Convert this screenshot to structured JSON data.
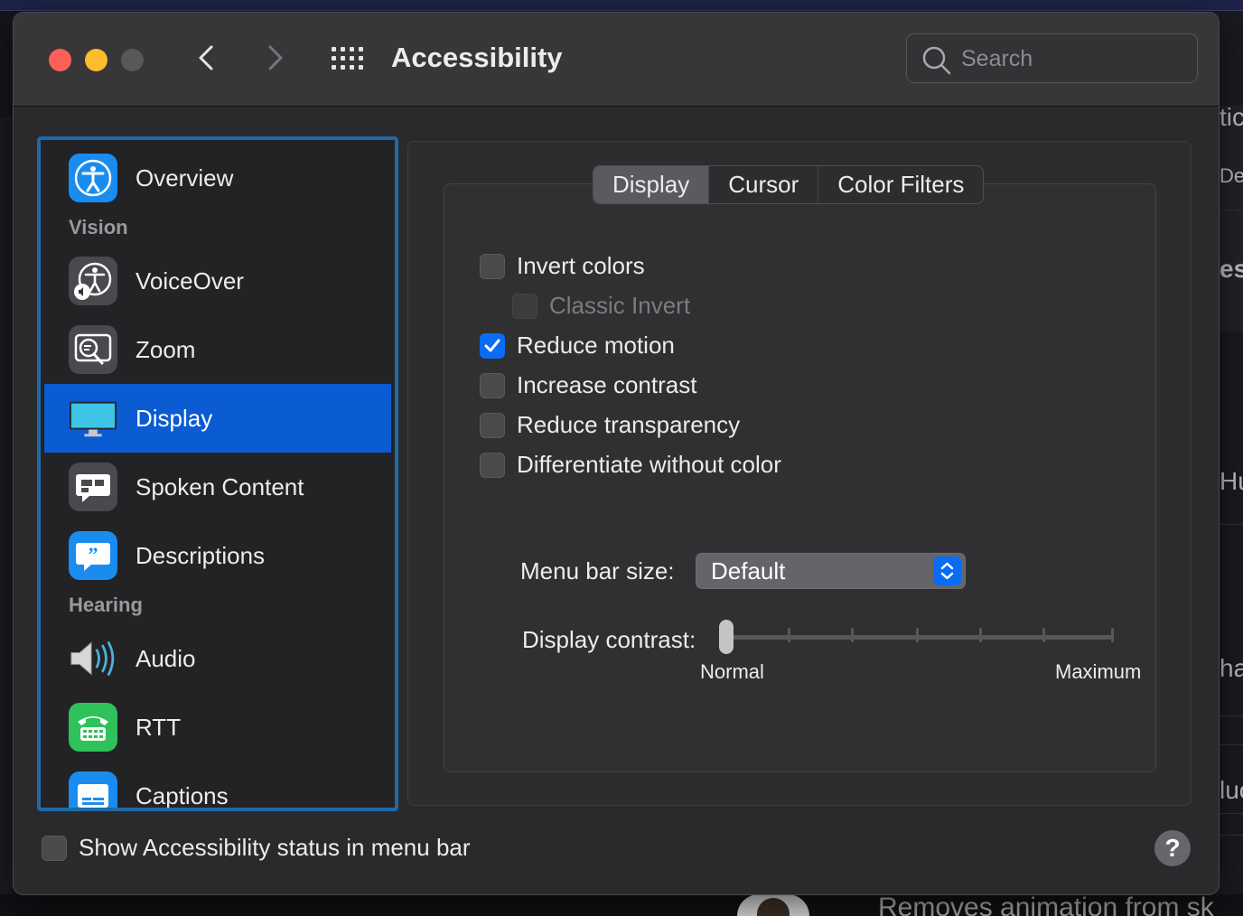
{
  "window": {
    "title": "Accessibility"
  },
  "search": {
    "placeholder": "Search"
  },
  "sidebar": {
    "items": [
      {
        "label": "Overview"
      },
      {
        "label": "VoiceOver"
      },
      {
        "label": "Zoom"
      },
      {
        "label": "Display"
      },
      {
        "label": "Spoken Content"
      },
      {
        "label": "Descriptions"
      },
      {
        "label": "Audio"
      },
      {
        "label": "RTT"
      },
      {
        "label": "Captions"
      }
    ],
    "sections": {
      "vision": "Vision",
      "hearing": "Hearing"
    },
    "selected": "Display"
  },
  "tabs": [
    {
      "label": "Display",
      "active": true
    },
    {
      "label": "Cursor",
      "active": false
    },
    {
      "label": "Color Filters",
      "active": false
    }
  ],
  "options": {
    "invert_colors": {
      "label": "Invert colors",
      "checked": false
    },
    "classic_invert": {
      "label": "Classic Invert",
      "checked": false,
      "disabled": true
    },
    "reduce_motion": {
      "label": "Reduce motion",
      "checked": true
    },
    "increase_contrast": {
      "label": "Increase contrast",
      "checked": false
    },
    "reduce_transparency": {
      "label": "Reduce transparency",
      "checked": false
    },
    "differentiate": {
      "label": "Differentiate without color",
      "checked": false
    }
  },
  "menu_bar_size": {
    "label": "Menu bar size:",
    "value": "Default"
  },
  "display_contrast": {
    "label": "Display contrast:",
    "min_label": "Normal",
    "max_label": "Maximum",
    "value": 0
  },
  "footer": {
    "status_label": "Show Accessibility status in menu bar",
    "status_checked": false,
    "help": "?"
  },
  "background": {
    "right_fragments": [
      "tic",
      "De",
      "es",
      "Hu",
      "ha",
      "luc"
    ],
    "bottom_text": "Removes animation from sk"
  },
  "colors": {
    "accent": "#0a6cf5",
    "selection": "#0b5bd2",
    "focus_ring": "#1e6aa7"
  }
}
